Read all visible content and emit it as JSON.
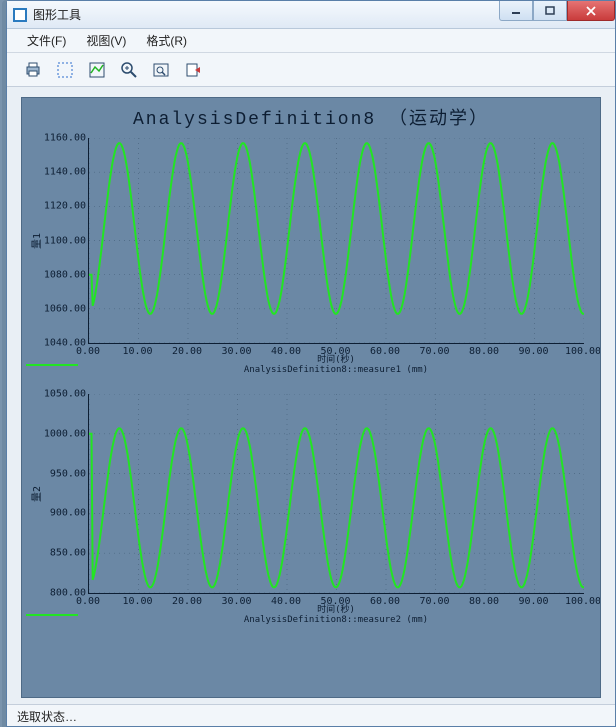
{
  "window": {
    "title": "图形工具"
  },
  "menu": {
    "file": "文件(F)",
    "view": "视图(V)",
    "format": "格式(R)"
  },
  "toolbar_icons": {
    "print": "print-icon",
    "select_region": "select-region-icon",
    "toggle_series": "toggle-series-icon",
    "zoom": "zoom-icon",
    "zoom_fit": "zoom-fit-icon",
    "export": "export-icon"
  },
  "status": "选取状态…",
  "chart_data": [
    {
      "type": "line",
      "title": "AnalysisDefinition8 （运动学）",
      "xlabel": "时间(秒)",
      "subcaption": "AnalysisDefinition8::measure1 (mm)",
      "ylabel": "量1",
      "xlim": [
        0,
        100
      ],
      "ylim": [
        1040,
        1160
      ],
      "xticks": [
        0,
        10,
        20,
        30,
        40,
        50,
        60,
        70,
        80,
        90,
        100
      ],
      "yticks": [
        1040,
        1060,
        1080,
        1100,
        1120,
        1140,
        1160
      ],
      "series": [
        {
          "name": "measure1",
          "color": "#22e522",
          "amplitude": 50,
          "offset": 1107,
          "period": 12.5,
          "phase": 3,
          "start_value": 1080
        }
      ]
    },
    {
      "type": "line",
      "xlabel": "时间(秒)",
      "subcaption": "AnalysisDefinition8::measure2 (mm)",
      "ylabel": "量2",
      "xlim": [
        0,
        100
      ],
      "ylim": [
        800,
        1050
      ],
      "xticks": [
        0,
        10,
        20,
        30,
        40,
        50,
        60,
        70,
        80,
        90,
        100
      ],
      "yticks": [
        800,
        850,
        900,
        950,
        1000,
        1050
      ],
      "series": [
        {
          "name": "measure2",
          "color": "#22e522",
          "amplitude": 100,
          "offset": 907,
          "period": 12.5,
          "phase": 3,
          "start_value": 1000
        }
      ]
    }
  ]
}
